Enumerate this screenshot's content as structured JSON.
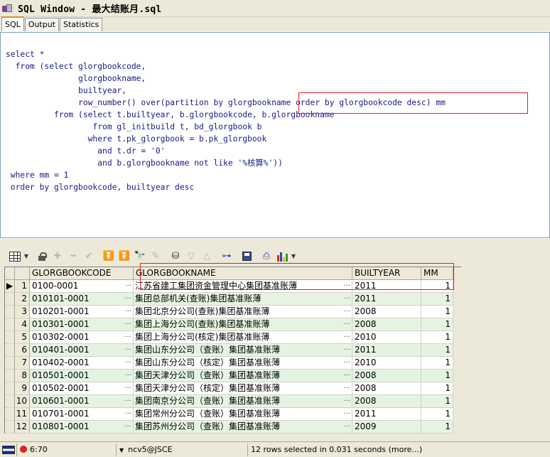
{
  "window": {
    "title": "SQL Window - 最大结账月.sql"
  },
  "tabs": [
    {
      "label": "SQL",
      "active": true
    },
    {
      "label": "Output",
      "active": false
    },
    {
      "label": "Statistics",
      "active": false
    }
  ],
  "editor": {
    "lines": [
      "select *",
      "  from (select glorgbookcode,",
      "               glorgbookname,",
      "               builtyear,",
      "               row_number() over(partition by glorgbookname order by glorgbookcode desc) mm",
      "          from (select t.builtyear, b.glorgbookcode, b.glorgbookname",
      "                  from gl_initbuild t, bd_glorgbook b",
      "                 where t.pk_glorgbook = b.pk_glorgbook",
      "                   and t.dr = '0'",
      "                   and b.glorgbookname not like '%核算%'))",
      " where mm = 1",
      " order by glorgbookcode, builtyear desc"
    ]
  },
  "toolbar": {
    "icons": [
      "grid-icon",
      "dropdown-icon",
      "lock-icon",
      "add-icon",
      "delete-icon",
      "check-icon",
      "next-record-icon",
      "last-record-icon",
      "find-icon",
      "clear-icon",
      "query-icon",
      "filter-down-icon",
      "filter-up-icon",
      "tree-icon",
      "save-icon",
      "print-icon",
      "chart-icon",
      "dropdown-icon"
    ]
  },
  "grid": {
    "columns": [
      "GLORGBOOKCODE",
      "GLORGBOOKNAME",
      "BUILTYEAR",
      "MM"
    ],
    "rows": [
      {
        "n": "1",
        "code": "0100-0001",
        "name": "江苏省建工集团资金管理中心集团基准账薄",
        "year": "2011",
        "mm": "1"
      },
      {
        "n": "2",
        "code": "010101-0001",
        "name": "集团总部机关(查账)集团基准账薄",
        "year": "2011",
        "mm": "1"
      },
      {
        "n": "3",
        "code": "010201-0001",
        "name": "集团北京分公司(查账)集团基准账薄",
        "year": "2008",
        "mm": "1"
      },
      {
        "n": "4",
        "code": "010301-0001",
        "name": "集团上海分公司(查账)集团基准账薄",
        "year": "2008",
        "mm": "1"
      },
      {
        "n": "5",
        "code": "010302-0001",
        "name": "集团上海分公司(核定)集团基准账薄",
        "year": "2010",
        "mm": "1"
      },
      {
        "n": "6",
        "code": "010401-0001",
        "name": "集团山东分公司（查账）集团基准账薄",
        "year": "2011",
        "mm": "1"
      },
      {
        "n": "7",
        "code": "010402-0001",
        "name": "集团山东分公司（核定）集团基准账薄",
        "year": "2010",
        "mm": "1"
      },
      {
        "n": "8",
        "code": "010501-0001",
        "name": "集团天津分公司（查账）集团基准账薄",
        "year": "2008",
        "mm": "1"
      },
      {
        "n": "9",
        "code": "010502-0001",
        "name": "集团天津分公司（核定）集团基准账薄",
        "year": "2008",
        "mm": "1"
      },
      {
        "n": "10",
        "code": "010601-0001",
        "name": "集团南京分公司（查账）集团基准账薄",
        "year": "2008",
        "mm": "1"
      },
      {
        "n": "11",
        "code": "010701-0001",
        "name": "集团常州分公司（查账）集团基准账薄",
        "year": "2011",
        "mm": "1"
      },
      {
        "n": "12",
        "code": "010801-0001",
        "name": "集团苏州分公司（查账）集团基准账薄",
        "year": "2009",
        "mm": "1"
      }
    ]
  },
  "statusbar": {
    "position": "6:70",
    "connection": "ncv5@JSCE",
    "message": "12 rows selected in 0.031 seconds (more...)"
  },
  "colors": {
    "keyword": "#1a1a8a",
    "highlight_box": "#e02020",
    "row_alt": "#e4f4e0"
  }
}
